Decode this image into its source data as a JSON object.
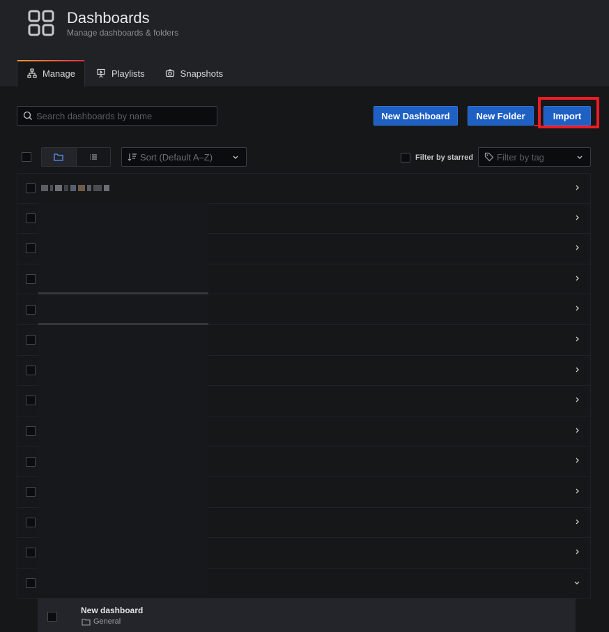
{
  "page": {
    "title": "Dashboards",
    "subtitle": "Manage dashboards & folders"
  },
  "tabs": [
    {
      "label": "Manage",
      "icon": "sitemap-icon",
      "active": true
    },
    {
      "label": "Playlists",
      "icon": "presentation-icon",
      "active": false
    },
    {
      "label": "Snapshots",
      "icon": "camera-icon",
      "active": false
    }
  ],
  "search": {
    "placeholder": "Search dashboards by name",
    "value": ""
  },
  "actions": {
    "new_dashboard": "New Dashboard",
    "new_folder": "New Folder",
    "import": "Import"
  },
  "toolbar": {
    "sort_placeholder": "Sort (Default A–Z)",
    "filter_starred": "Filter by starred",
    "tag_placeholder": "Filter by tag"
  },
  "folder_rows_count": 14,
  "expanded_child": {
    "name": "New dashboard",
    "folder": "General"
  },
  "colors": {
    "primary_button": "#1f60c4",
    "highlight_box": "#ee1c24",
    "background": "#161719",
    "header": "#202226"
  }
}
